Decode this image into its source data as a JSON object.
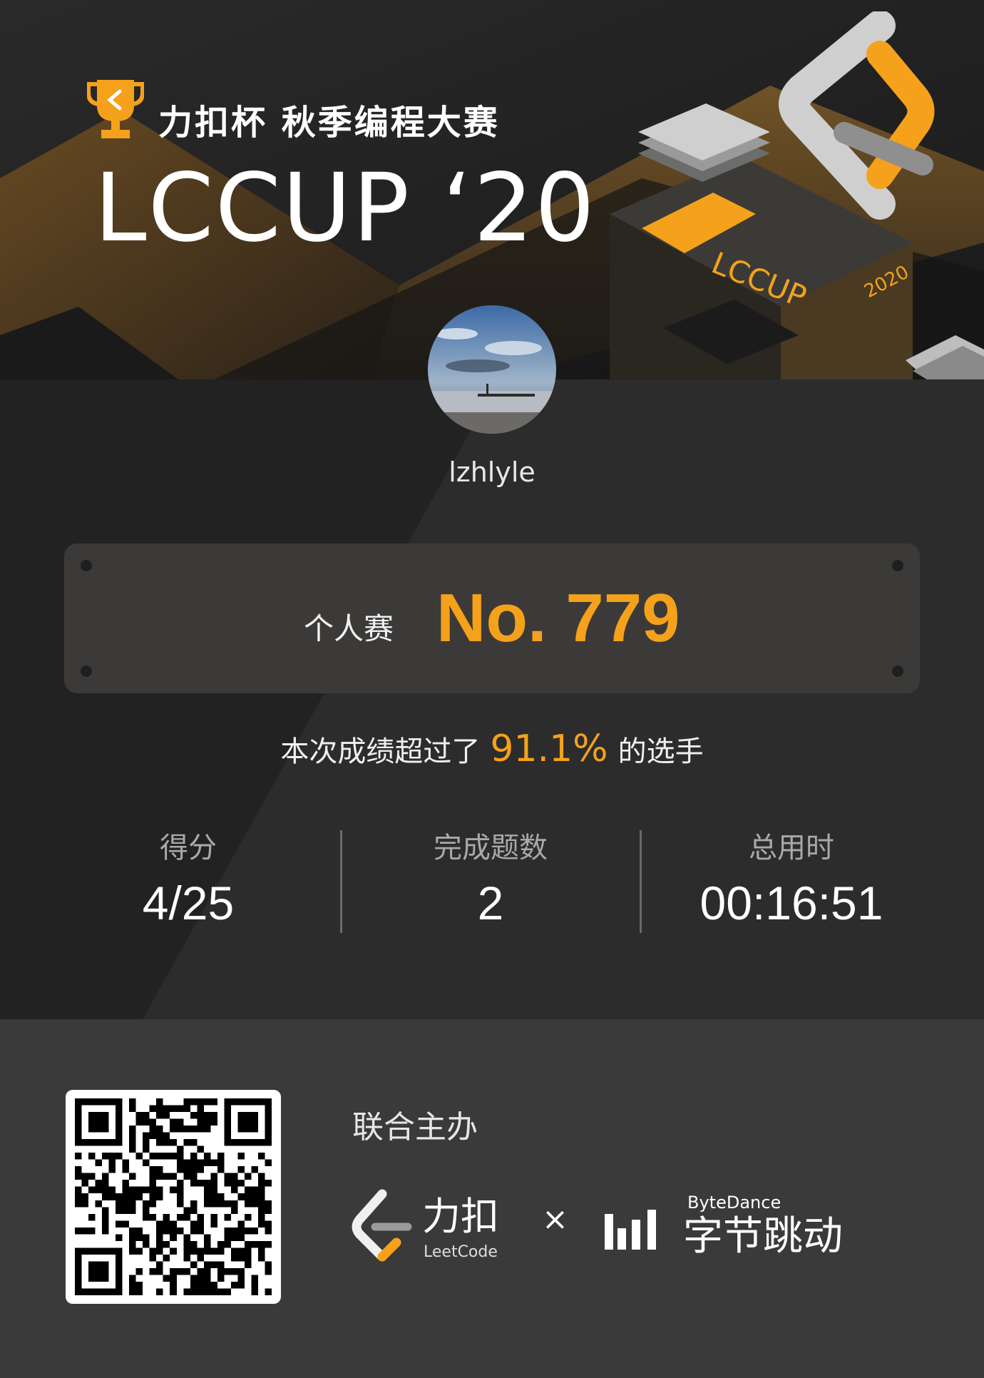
{
  "banner": {
    "subtitle": "力扣杯 秋季编程大赛",
    "title": "LCCUP ‘20",
    "box_text": "LCCUP",
    "box_year": "2020"
  },
  "profile": {
    "username": "lzhlyle"
  },
  "rank": {
    "label": "个人赛",
    "value": "No. 779"
  },
  "percentile": {
    "prefix": "本次成绩超过了",
    "value": "91.1%",
    "suffix": "的选手"
  },
  "stats": [
    {
      "label": "得分",
      "value": "4/25"
    },
    {
      "label": "完成题数",
      "value": "2"
    },
    {
      "label": "总用时",
      "value": "00:16:51"
    }
  ],
  "footer": {
    "co_host": "联合主办",
    "leetcode_cn": "力扣",
    "leetcode_en": "LeetCode",
    "times": "×",
    "bytedance_en": "ByteDance",
    "bytedance_cn": "字节跳动"
  },
  "colors": {
    "accent": "#f5a11b",
    "background": "#262626",
    "footer": "#3a3a3a"
  },
  "icons": {
    "trophy": "trophy-icon",
    "qr": "qr-code",
    "leetcode": "leetcode-logo",
    "bytedance": "bytedance-logo"
  }
}
